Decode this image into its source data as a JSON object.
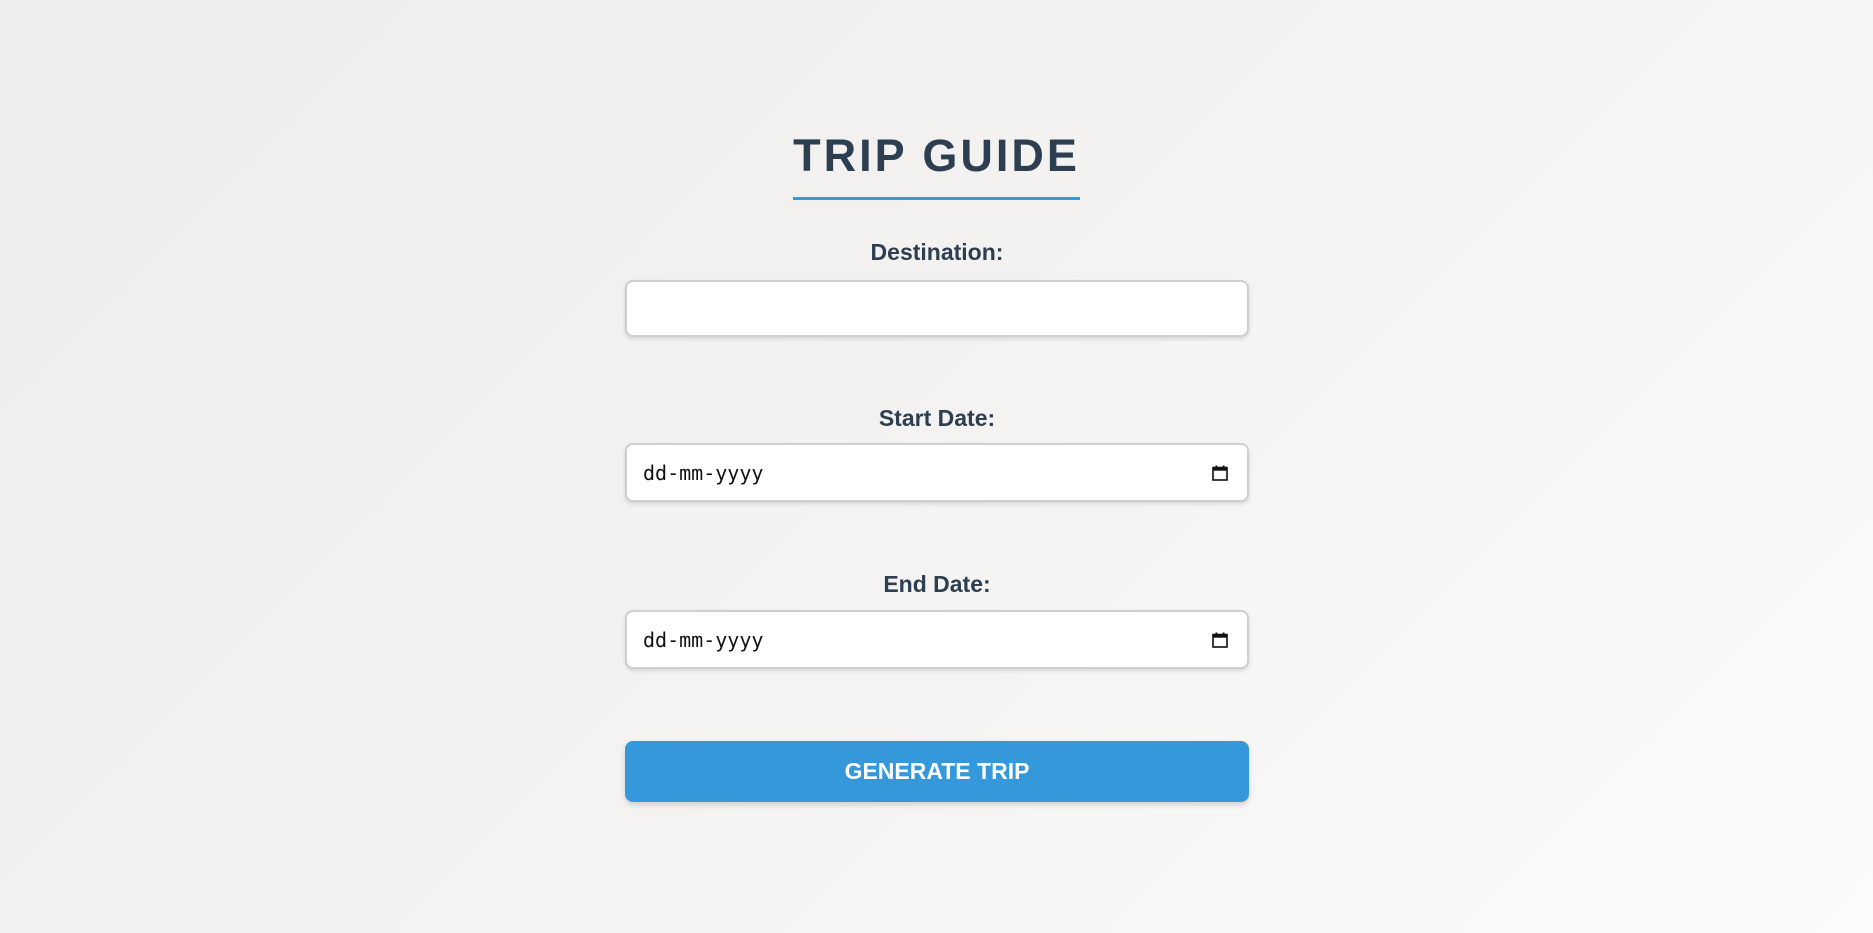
{
  "app": {
    "title": "TRIP GUIDE"
  },
  "form": {
    "destination": {
      "label": "Destination:",
      "value": ""
    },
    "start_date": {
      "label": "Start Date:",
      "placeholder": "dd-mm-yyyy"
    },
    "end_date": {
      "label": "End Date:",
      "placeholder": "dd-mm-yyyy"
    },
    "submit_label": "GENERATE TRIP"
  },
  "icons": {
    "date_picker": "calendar-icon"
  },
  "colors": {
    "accent": "#3498db",
    "text": "#2c3e50",
    "button_text": "#ffffff"
  }
}
